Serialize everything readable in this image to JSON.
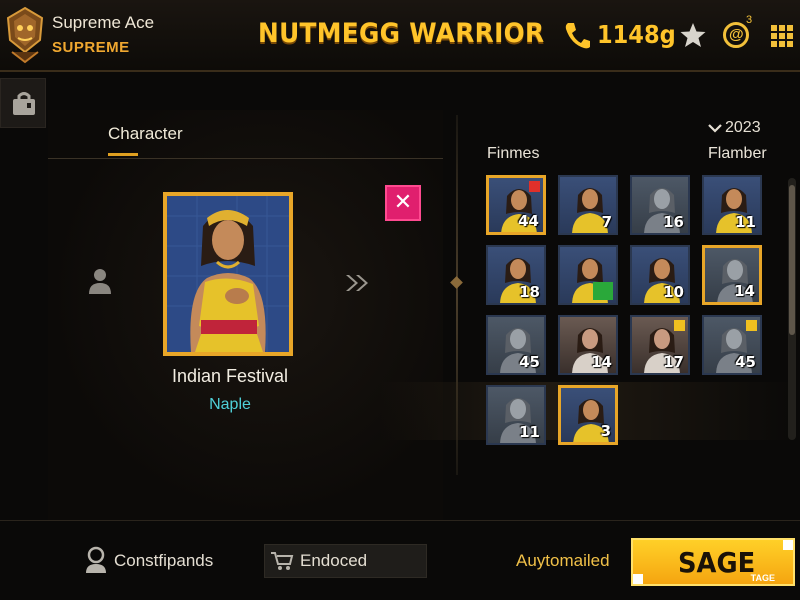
{
  "header": {
    "player_name": "Supreme Ace",
    "player_rank": "SUPREME",
    "game_title": "NUTMEGG WARRIOR",
    "currency": "1148g",
    "badge_count": "3",
    "icons": [
      "emblem-icon",
      "phone-icon",
      "star-icon",
      "badge-icon",
      "grid-menu-icon"
    ]
  },
  "character_panel": {
    "tab_label": "Character",
    "name": "Indian Festival",
    "subtitle": "Naple"
  },
  "roster": {
    "year": "2023",
    "col_left": "Finmes",
    "col_right": "Flamber",
    "tiles": [
      {
        "level": "44",
        "style": "color",
        "selected": true
      },
      {
        "level": "7",
        "style": "color",
        "selected": false
      },
      {
        "level": "16",
        "style": "gray",
        "selected": false
      },
      {
        "level": "11",
        "style": "color",
        "selected": false
      },
      {
        "level": "18",
        "style": "color",
        "selected": false
      },
      {
        "level": "",
        "style": "color",
        "selected": false
      },
      {
        "level": "10",
        "style": "color",
        "selected": false
      },
      {
        "level": "14",
        "style": "gray",
        "selected": true
      },
      {
        "level": "45",
        "style": "gray",
        "selected": false
      },
      {
        "level": "14",
        "style": "photo",
        "selected": false
      },
      {
        "level": "17",
        "style": "photo",
        "selected": false
      },
      {
        "level": "45",
        "style": "gray",
        "selected": false
      },
      {
        "level": "11",
        "style": "gray",
        "selected": false
      },
      {
        "level": "3",
        "style": "color",
        "selected": true
      }
    ]
  },
  "bottom": {
    "left_label": "Constfipands",
    "encoded_label": "Endoced",
    "auto_label": "Auytomailed",
    "action_label": "SAGE",
    "action_small": "TAGE"
  },
  "colors": {
    "accent": "#ffc42a",
    "selected_border": "#e8a628",
    "close_button": "#e01f6e",
    "subtitle": "#4fd0d8"
  }
}
